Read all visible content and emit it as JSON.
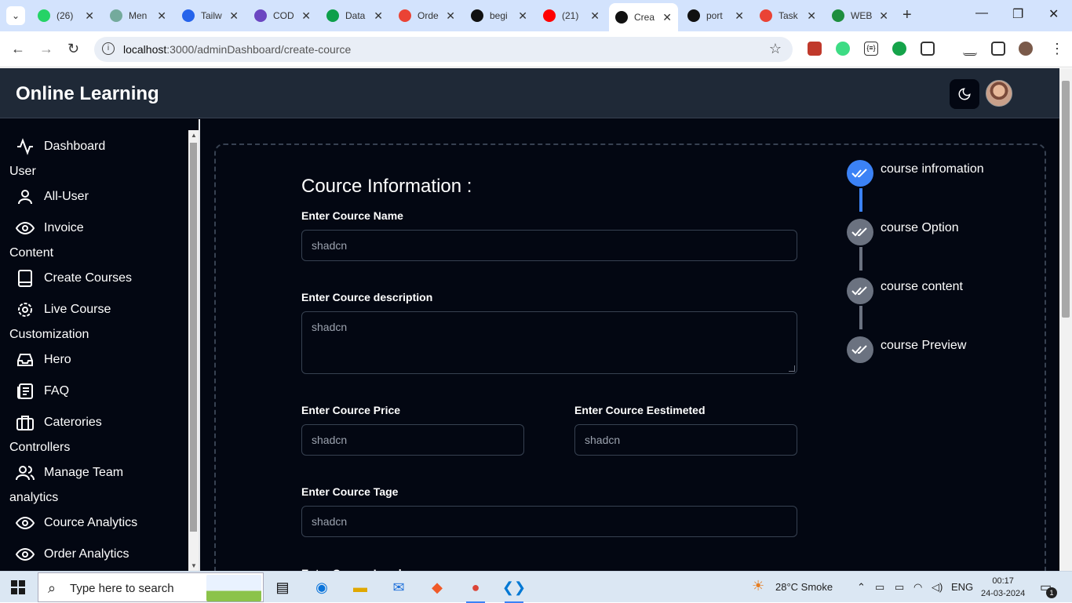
{
  "browser": {
    "tabs": [
      {
        "title": "(26)",
        "color": "#25d366"
      },
      {
        "title": "Men",
        "color": "#74aa9c"
      },
      {
        "title": "Tailw",
        "color": "#2563eb"
      },
      {
        "title": "COD",
        "color": "#6b46c1"
      },
      {
        "title": "Data",
        "color": "#0d9f4a"
      },
      {
        "title": "Orde",
        "color": "#ea4335"
      },
      {
        "title": "begi",
        "color": "#111111"
      },
      {
        "title": "(21)",
        "color": "#ff0000"
      },
      {
        "title": "Crea",
        "color": "#111111",
        "active": true
      },
      {
        "title": "port",
        "color": "#111111"
      },
      {
        "title": "Task",
        "color": "#ea4335"
      },
      {
        "title": "WEB",
        "color": "#1e8e3e"
      }
    ],
    "url_host": "localhost",
    "url_path": ":3000/adminDashboard/create-cource"
  },
  "app": {
    "brand": "Online Learning",
    "sidebar": {
      "dashboard": "Dashboard",
      "group_user": "User",
      "all_user": "All-User",
      "invoice": "Invoice",
      "group_content": "Content",
      "create_courses": "Create Courses",
      "live_course": "Live Course",
      "group_customization": "Customization",
      "hero": "Hero",
      "faq": "FAQ",
      "categories": "Caterories",
      "group_controllers": "Controllers",
      "manage_team": "Manage Team",
      "group_analytics": "analytics",
      "cource_analytics": "Cource Analytics",
      "order_analytics": "Order Analytics"
    },
    "form": {
      "title": "Cource Information :",
      "name_label": "Enter Cource Name",
      "name_placeholder": "shadcn",
      "description_label": "Enter Cource description",
      "description_placeholder": "shadcn",
      "price_label": "Enter Cource Price",
      "price_placeholder": "shadcn",
      "estimated_label": "Enter Cource Eestimeted",
      "estimated_placeholder": "shadcn",
      "tags_label": "Enter Cource Tage",
      "tags_placeholder": "shadcn",
      "partial_label": "Enter Cource Level"
    },
    "steps": [
      {
        "label": "course infromation",
        "active": true
      },
      {
        "label": "course Option",
        "active": false
      },
      {
        "label": "course content",
        "active": false
      },
      {
        "label": "course Preview",
        "active": false
      }
    ]
  },
  "taskbar": {
    "search_placeholder": "Type here to search",
    "weather": "28°C  Smoke",
    "language": "ENG",
    "time": "00:17",
    "date": "24-03-2024",
    "notification_count": "1"
  }
}
